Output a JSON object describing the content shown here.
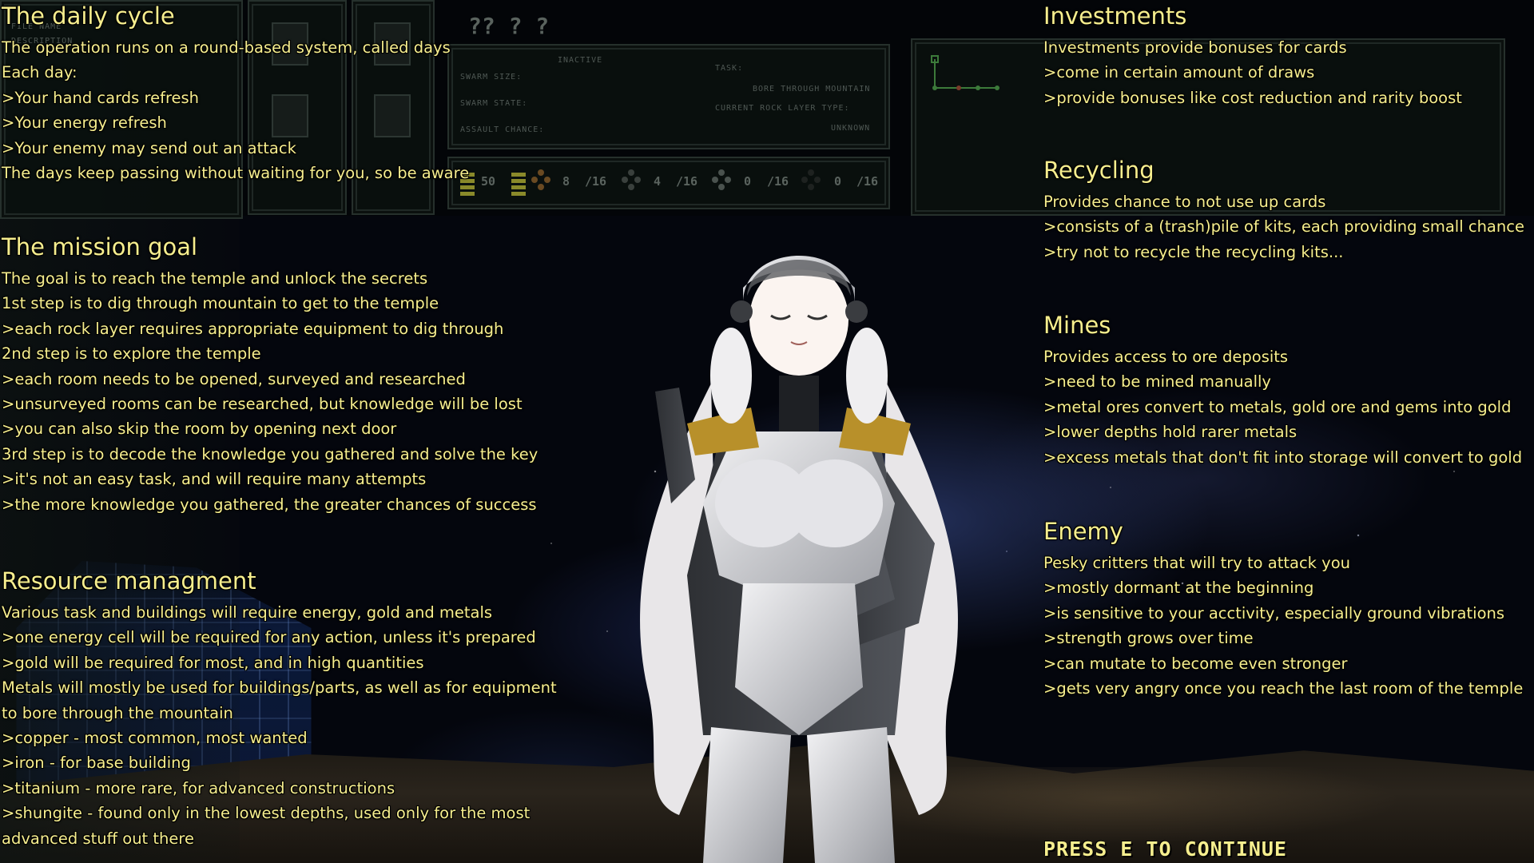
{
  "hud": {
    "question_marks": "?? ? ?",
    "file_name": "FILE NAME",
    "description": "DESCRIPTION",
    "swarm_status": "INACTIVE",
    "swarm_size_label": "SWARM SIZE:",
    "swarm_state_label": "SWARM STATE:",
    "assault_chance_label": "ASSAULT CHANCE:",
    "task_label": "TASK:",
    "task_value": "BORE THROUGH MOUNTAIN",
    "rock_layer_label": "CURRENT ROCK LAYER TYPE:",
    "rock_layer_value": "UNKNOWN",
    "energy_value": "50",
    "resources": [
      {
        "value": "8",
        "max": "/16"
      },
      {
        "value": "4",
        "max": "/16"
      },
      {
        "value": "0",
        "max": "/16"
      },
      {
        "value": "0",
        "max": "/16"
      }
    ]
  },
  "left_column": [
    {
      "title": "The daily cycle",
      "lines": [
        "The operation runs on a round-based system, called days",
        "Each day:",
        ">Your hand cards refresh",
        ">Your energy refresh",
        ">Your enemy may send out an attack",
        "The days keep passing without waiting for you, so be aware"
      ]
    },
    {
      "title": "The mission goal",
      "lines": [
        "The goal is to reach the temple and unlock the secrets",
        "1st step is to dig through mountain to get to the temple",
        ">each rock layer requires appropriate equipment to dig through",
        "2nd step is to explore the temple",
        ">each room needs to be opened, surveyed and researched",
        ">unsurveyed rooms can be researched, but knowledge will be lost",
        ">you can also skip the room by opening next door",
        "3rd step is to decode the knowledge you gathered and solve the key",
        ">it's not an easy task, and will require many attempts",
        ">the more knowledge you gathered, the greater chances of success"
      ]
    },
    {
      "title": "Resource managment",
      "lines": [
        "Various task and buildings will require energy, gold and metals",
        ">one energy cell will be required for any action, unless it's prepared",
        ">gold will be required for most, and in high quantities",
        "Metals will mostly be used for buildings/parts, as well as for equipment",
        "to bore through the mountain",
        ">copper - most common, most wanted",
        ">iron - for base building",
        ">titanium - more rare, for advanced constructions",
        ">shungite - found only in the lowest depths, used only for the most",
        "advanced stuff out there"
      ]
    }
  ],
  "right_column": [
    {
      "title": "Investments",
      "lines": [
        "Investments provide bonuses for cards",
        ">come in certain amount of draws",
        ">provide bonuses like cost reduction and rarity boost"
      ]
    },
    {
      "title": "Recycling",
      "lines": [
        "Provides chance to not use up cards",
        ">consists of a (trash)pile of kits, each providing small chance",
        ">try not to recycle the recycling kits..."
      ]
    },
    {
      "title": "Mines",
      "lines": [
        "Provides access to ore deposits",
        ">need to be mined manually",
        ">metal ores convert to metals, gold ore and gems into gold",
        ">lower depths hold rarer metals",
        ">excess metals that don't fit into storage will convert to gold"
      ]
    },
    {
      "title": "Enemy",
      "lines": [
        "Pesky critters that will try to attack you",
        ">mostly dormant at the beginning",
        ">is sensitive to your acctivity, especially ground vibrations",
        ">strength grows over time",
        ">can mutate to become even stronger",
        ">gets very angry once you reach the last room of the temple"
      ]
    }
  ],
  "continue_prompt": "PRESS E TO CONTINUE",
  "colors": {
    "text": "#f6ee8e",
    "hud_panel": "#0a100e",
    "hud_border": "#26302c"
  }
}
